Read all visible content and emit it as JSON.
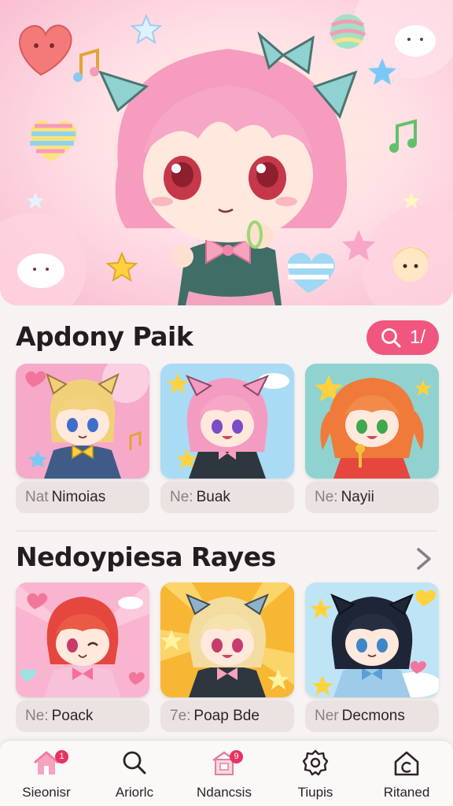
{
  "hero": {
    "icon_set": [
      "heart-icon",
      "star-icon",
      "music-note-icon",
      "cloud-icon",
      "candy-ball-icon"
    ]
  },
  "section_one": {
    "title": "Apdony Paik",
    "search_count": "1/",
    "cards": [
      {
        "prefix": "Nat",
        "name": "Nimoias"
      },
      {
        "prefix": "Ne:",
        "name": "Buak"
      },
      {
        "prefix": "Ne:",
        "name": "Nayii"
      }
    ]
  },
  "section_two": {
    "title": "Nedoypiesa Rayes",
    "cards": [
      {
        "prefix": "Ne:",
        "name": "Poack"
      },
      {
        "prefix": "7e:",
        "name": "Poap Bde"
      },
      {
        "prefix": "Ner",
        "name": "Decmons"
      }
    ]
  },
  "bottom_nav": {
    "items": [
      {
        "label": "Sieonisr",
        "icon": "home-icon",
        "badge": "1"
      },
      {
        "label": "Ariorlc",
        "icon": "search-icon"
      },
      {
        "label": "Ndancsis",
        "icon": "shop-icon",
        "badge": "9"
      },
      {
        "label": "Tiupis",
        "icon": "settings-icon"
      },
      {
        "label": "Ritaned",
        "icon": "house-c-icon"
      }
    ]
  },
  "colors": {
    "accent": "#f0567e",
    "background": "#f6f3f2",
    "label_bg": "#ebe3e2"
  }
}
